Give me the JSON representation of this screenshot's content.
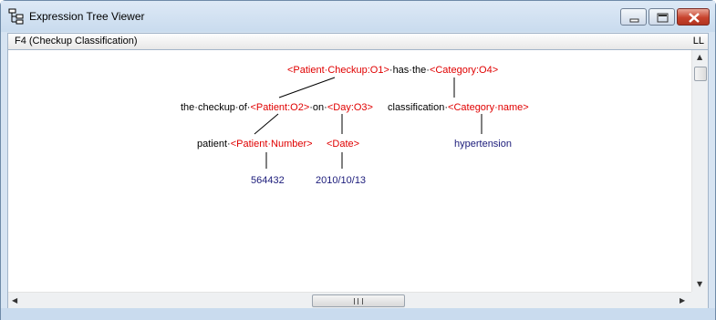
{
  "window": {
    "title": "Expression Tree Viewer"
  },
  "header": {
    "title": "F4 (Checkup Classification)",
    "right_label": "LL"
  },
  "tree": {
    "root": {
      "part1": "<Patient·Checkup:O1>",
      "part2": "·has·the·",
      "part3": "<Category:O4>"
    },
    "left": {
      "part1": "the·checkup·of·",
      "part2": "<Patient:O2>",
      "part3": "·on·",
      "part4": "<Day:O3>"
    },
    "right": {
      "part1": "classification·",
      "part2": "<Category·name>"
    },
    "patient": {
      "part1": "patient·",
      "part2": "<Patient·Number>"
    },
    "date": "<Date>",
    "category_value": "hypertension",
    "patient_number_value": "564432",
    "date_value": "2010/10/13"
  },
  "scrollbars": {
    "up_arrow": "▲",
    "down_arrow": "▼",
    "left_arrow": "◀",
    "right_arrow": "▶"
  },
  "colors": {
    "placeholder": "#e00000",
    "value": "#1b1b7a",
    "text": "#000000"
  }
}
